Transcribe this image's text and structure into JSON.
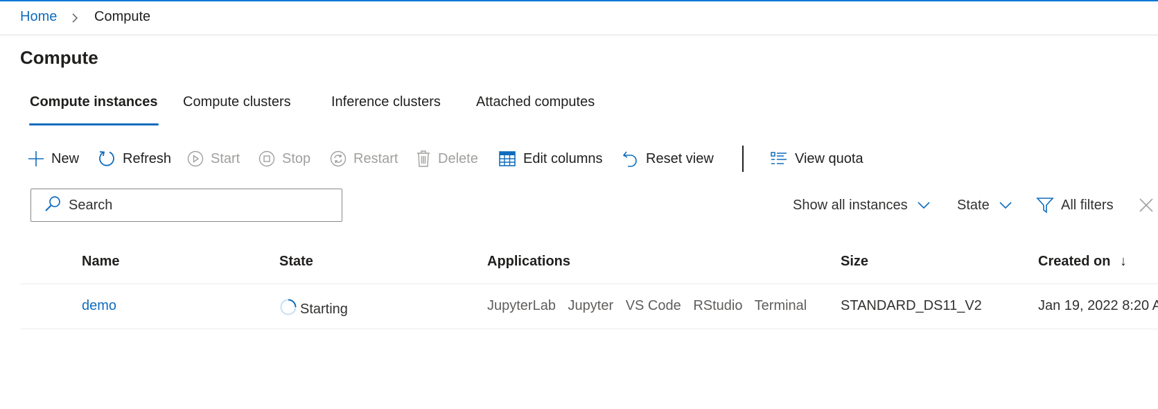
{
  "breadcrumb": {
    "home": "Home",
    "current": "Compute"
  },
  "page": {
    "title": "Compute"
  },
  "tabs": [
    {
      "label": "Compute instances",
      "active": true
    },
    {
      "label": "Compute clusters",
      "active": false
    },
    {
      "label": "Inference clusters",
      "active": false
    },
    {
      "label": "Attached computes",
      "active": false
    }
  ],
  "toolbar": {
    "new": "New",
    "refresh": "Refresh",
    "start": "Start",
    "stop": "Stop",
    "restart": "Restart",
    "delete": "Delete",
    "edit_columns": "Edit columns",
    "reset_view": "Reset view",
    "view_quota": "View quota"
  },
  "search": {
    "placeholder": "Search",
    "value": ""
  },
  "filters": {
    "show_all": "Show all instances",
    "state": "State",
    "all_filters": "All filters"
  },
  "table": {
    "columns": [
      "Name",
      "State",
      "Applications",
      "Size",
      "Created on"
    ],
    "sort_indicator": "↓",
    "rows": [
      {
        "name": "demo",
        "state": "Starting",
        "applications": [
          "JupyterLab",
          "Jupyter",
          "VS Code",
          "RStudio",
          "Terminal"
        ],
        "size": "STANDARD_DS11_V2",
        "created_on": "Jan 19, 2022 8:20 A"
      }
    ]
  },
  "colors": {
    "accent": "#0078d4",
    "link": "#0f6cbd",
    "disabled": "#a19f9d"
  },
  "icons": {
    "breadcrumb_sep": "chevron-right-icon",
    "new": "plus-icon",
    "refresh": "refresh-icon",
    "start": "play-icon",
    "stop": "stop-icon",
    "restart": "restart-icon",
    "delete": "trash-icon",
    "edit_columns": "table-icon",
    "reset_view": "undo-icon",
    "view_quota": "list-icon",
    "search": "search-icon",
    "filter": "filter-icon",
    "close": "close-icon",
    "state_starting": "spinner-icon"
  }
}
